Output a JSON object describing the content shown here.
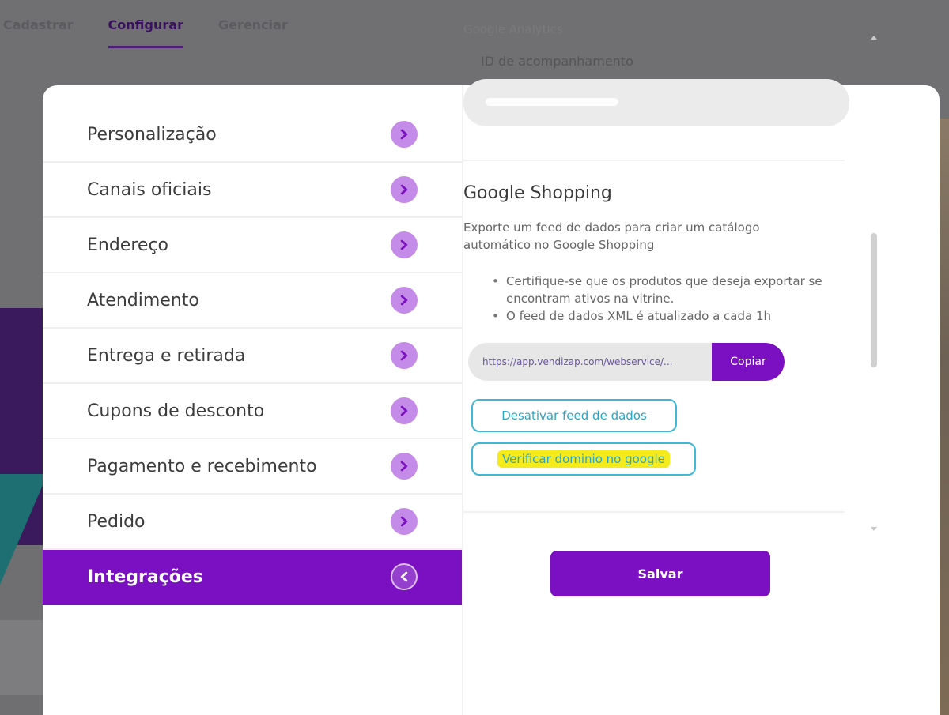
{
  "top_tabs": [
    {
      "label": "Cadastrar"
    },
    {
      "label": "Configurar"
    },
    {
      "label": "Gerenciar"
    }
  ],
  "sidebar": {
    "items": [
      {
        "label": "Personalização",
        "icon": "chevron-right-icon"
      },
      {
        "label": "Canais oficiais",
        "icon": "chevron-right-icon"
      },
      {
        "label": "Endereço",
        "icon": "chevron-right-icon"
      },
      {
        "label": "Atendimento",
        "icon": "chevron-right-icon"
      },
      {
        "label": "Entrega e retirada",
        "icon": "chevron-right-icon"
      },
      {
        "label": "Cupons de desconto",
        "icon": "chevron-right-icon"
      },
      {
        "label": "Pagamento e recebimento",
        "icon": "chevron-right-icon"
      },
      {
        "label": "Pedido",
        "icon": "chevron-right-icon"
      },
      {
        "label": "Integrações",
        "icon": "chevron-left-icon",
        "active": true
      }
    ]
  },
  "analytics": {
    "heading": "Google Analytics",
    "field_label": "ID de acompanhamento",
    "field_value": ""
  },
  "shopping": {
    "title": "Google Shopping",
    "description": "Exporte um feed de dados para criar um catálogo automático no Google Shopping",
    "bullets": [
      "Certifique-se que os produtos que deseja exportar se encontram ativos na vitrine.",
      "O feed de dados XML é atualizado a cada 1h"
    ],
    "feed_url": "https://app.vendizap.com/webservice/...",
    "copy_label": "Copiar",
    "disable_label": "Desativar feed de dados",
    "verify_label": "Verificar dominio no google"
  },
  "footer": {
    "save_label": "Salvar"
  },
  "colors": {
    "accent": "#7b0fc2",
    "chevron_bg": "#c48ce8",
    "outline_button": "#3fb7d6",
    "highlight": "#f4ea1c"
  }
}
